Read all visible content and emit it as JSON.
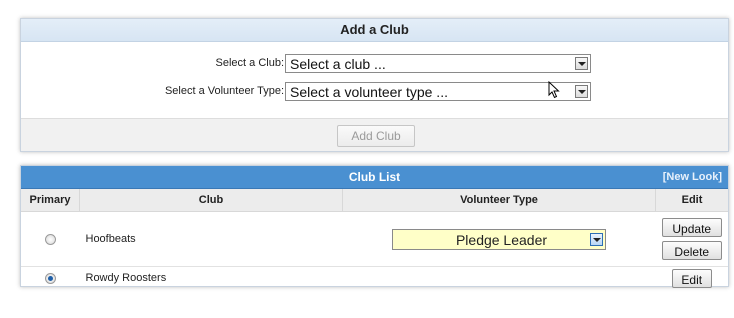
{
  "add_club": {
    "title": "Add a Club",
    "club_label": "Select a Club:",
    "club_value": "Select a club ...",
    "volunteer_label": "Select a Volunteer Type:",
    "volunteer_value": "Select a volunteer type ...",
    "add_button": "Add Club"
  },
  "club_list": {
    "title": "Club List",
    "new_look_link": "[New Look]",
    "columns": [
      "Primary",
      "Club",
      "Volunteer Type",
      "Edit"
    ],
    "rows": [
      {
        "primary_checked": false,
        "club": "Hoofbeats",
        "volunteer_type": "Pledge Leader",
        "buttons": [
          "Update",
          "Delete"
        ]
      },
      {
        "primary_checked": true,
        "club": "Rowdy Roosters",
        "volunteer_type": "",
        "buttons": [
          "Edit"
        ]
      }
    ]
  },
  "colors": {
    "list_header": "#4a90d1",
    "add_header": "#dbe7f4",
    "editing_select": "#ffffc8"
  },
  "icons": [
    "dropdown-arrow-icon",
    "mouse-cursor-icon",
    "radio-icon"
  ]
}
